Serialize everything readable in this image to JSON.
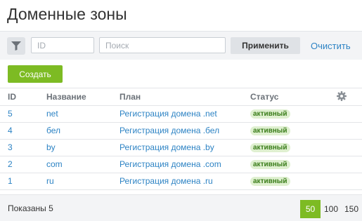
{
  "page": {
    "title": "Доменные зоны"
  },
  "filter": {
    "id_placeholder": "ID",
    "search_placeholder": "Поиск",
    "apply_label": "Применить",
    "clear_label": "Очистить"
  },
  "toolbar": {
    "create_label": "Создать"
  },
  "table": {
    "columns": {
      "id": "ID",
      "name": "Название",
      "plan": "План",
      "status": "Статус"
    },
    "rows": [
      {
        "id": "5",
        "name": "net",
        "plan": "Регистрация домена .net",
        "status": "активный"
      },
      {
        "id": "4",
        "name": "бел",
        "plan": "Регистрация домена .бел",
        "status": "активный"
      },
      {
        "id": "3",
        "name": "by",
        "plan": "Регистрация домена .by",
        "status": "активный"
      },
      {
        "id": "2",
        "name": "com",
        "plan": "Регистрация домена .com",
        "status": "активный"
      },
      {
        "id": "1",
        "name": "ru",
        "plan": "Регистрация домена .ru",
        "status": "активный"
      }
    ]
  },
  "footer": {
    "shown_label": "Показаны 5",
    "page_sizes": [
      "50",
      "100",
      "150"
    ],
    "active_page_size": "50"
  },
  "colors": {
    "accent": "#7dbb23",
    "link": "#2d83c4",
    "status_bg": "#dff0d0"
  }
}
